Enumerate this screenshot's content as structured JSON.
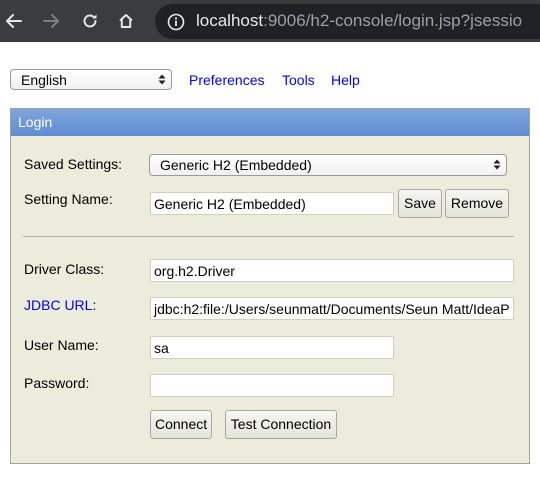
{
  "browser": {
    "url_host": "localhost",
    "url_rest": ":9006/h2-console/login.jsp?jsessio"
  },
  "toolbar": {
    "language": "English",
    "links": [
      "Preferences",
      "Tools",
      "Help"
    ]
  },
  "login": {
    "title": "Login",
    "saved_settings_label": "Saved Settings:",
    "saved_settings_value": "Generic H2 (Embedded)",
    "setting_name_label": "Setting Name:",
    "setting_name_value": "Generic H2 (Embedded)",
    "save_label": "Save",
    "remove_label": "Remove",
    "driver_class_label": "Driver Class:",
    "driver_class_value": "org.h2.Driver",
    "jdbc_url_label": "JDBC URL",
    "jdbc_url_colon": ":",
    "jdbc_url_value": "jdbc:h2:file:/Users/seunmatt/Documents/Seun Matt/IdeaP",
    "user_name_label": "User Name:",
    "user_name_value": "sa",
    "password_label": "Password:",
    "password_value": "",
    "connect_label": "Connect",
    "test_connection_label": "Test Connection"
  },
  "icons": {
    "back": "back-arrow-icon",
    "forward": "forward-arrow-icon",
    "reload": "reload-icon",
    "home": "home-icon",
    "info": "info-icon",
    "select": "select-updown-icon"
  },
  "colors": {
    "chrome_bg": "#3b3c3f",
    "omnibox_bg": "#202124",
    "panel_bg": "#ecebdc",
    "header_bg": "#6b97d6",
    "link": "#0000ee"
  }
}
